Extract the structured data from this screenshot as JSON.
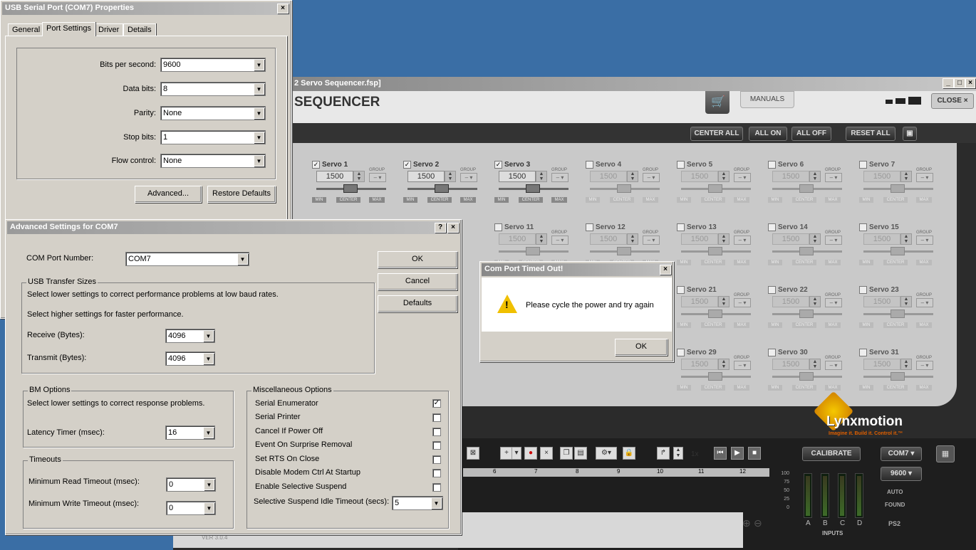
{
  "props_win": {
    "title": "USB Serial Port (COM7) Properties",
    "tabs": [
      "General",
      "Port Settings",
      "Driver",
      "Details"
    ],
    "fields": [
      {
        "label": "Bits per second:",
        "value": "9600"
      },
      {
        "label": "Data bits:",
        "value": "8"
      },
      {
        "label": "Parity:",
        "value": "None"
      },
      {
        "label": "Stop bits:",
        "value": "1"
      },
      {
        "label": "Flow control:",
        "value": "None"
      }
    ],
    "advanced_btn": "Advanced...",
    "restore_btn": "Restore Defaults",
    "close": "×"
  },
  "adv_win": {
    "title": "Advanced Settings for COM7",
    "help": "?",
    "close": "×",
    "com_label": "COM Port Number:",
    "com_value": "COM7",
    "ok": "OK",
    "cancel": "Cancel",
    "defaults": "Defaults",
    "usb_group": "USB Transfer Sizes",
    "usb_line1": "Select lower settings to correct performance problems at low baud rates.",
    "usb_line2": "Select higher settings for faster performance.",
    "receive_label": "Receive (Bytes):",
    "receive_value": "4096",
    "transmit_label": "Transmit (Bytes):",
    "transmit_value": "4096",
    "bm_group": "BM Options",
    "bm_line": "Select lower settings to correct response problems.",
    "latency_label": "Latency Timer (msec):",
    "latency_value": "16",
    "timeouts_group": "Timeouts",
    "min_read_label": "Minimum Read Timeout (msec):",
    "min_read_value": "0",
    "min_write_label": "Minimum Write Timeout (msec):",
    "min_write_value": "0",
    "misc_group": "Miscellaneous Options",
    "misc": [
      {
        "label": "Serial Enumerator",
        "checked": "✓"
      },
      {
        "label": "Serial Printer",
        "checked": ""
      },
      {
        "label": "Cancel If Power Off",
        "checked": ""
      },
      {
        "label": "Event On Surprise Removal",
        "checked": ""
      },
      {
        "label": "Set RTS On Close",
        "checked": ""
      },
      {
        "label": "Disable Modem Ctrl At Startup",
        "checked": ""
      },
      {
        "label": "Enable Selective Suspend",
        "checked": ""
      }
    ],
    "idle_label": "Selective Suspend Idle Timeout (secs):",
    "idle_value": "5"
  },
  "dialog": {
    "title": "Com Port Timed Out!",
    "message": "Please cycle the power and try again",
    "ok": "OK",
    "close": "×"
  },
  "seq": {
    "title": "2 Servo Sequencer.fsp]",
    "header": "SEQUENCER",
    "manuals": "MANUALS",
    "close": "CLOSE",
    "close_x": "×",
    "center_all": "CENTER ALL",
    "all_on": "ALL ON",
    "all_off": "ALL OFF",
    "reset_all": "RESET ALL",
    "calibrate": "CALIBRATE",
    "com": "COM7",
    "baud": "9600",
    "auto": "AUTO",
    "found": "FOUND",
    "ps2": "PS2",
    "inputs": "INPUTS",
    "input_labels": [
      "A",
      "B",
      "C",
      "D"
    ],
    "meter_ticks": [
      "100",
      "75",
      "50",
      "25",
      "0"
    ],
    "speed": "1x",
    "timeline_ticks": [
      "6",
      "7",
      "8",
      "9",
      "10",
      "11",
      "12"
    ],
    "version": "VER 3.0.4",
    "logo": "Lynxmotion",
    "tagline": "Imagine it. Build it. Control it.™",
    "servo_value": "1500",
    "group_label": "GROUP",
    "min": "MIN",
    "center": "CENTER",
    "max": "MAX",
    "group_val": "– ▾",
    "servos_row1": [
      {
        "name": "Servo 1",
        "on": "✓"
      },
      {
        "name": "Servo 2",
        "on": "✓"
      },
      {
        "name": "Servo 3",
        "on": "✓"
      },
      {
        "name": "Servo 4",
        "on": ""
      },
      {
        "name": "Servo 5",
        "on": ""
      },
      {
        "name": "Servo 6",
        "on": ""
      },
      {
        "name": "Servo 7",
        "on": ""
      }
    ],
    "servos_row2": [
      "Servo 11",
      "Servo 12",
      "Servo 13",
      "Servo 14",
      "Servo 15"
    ],
    "servos_row3": [
      "Servo 21",
      "Servo 22",
      "Servo 23"
    ],
    "servos_row4": [
      "Servo 29",
      "Servo 30",
      "Servo 31"
    ]
  }
}
